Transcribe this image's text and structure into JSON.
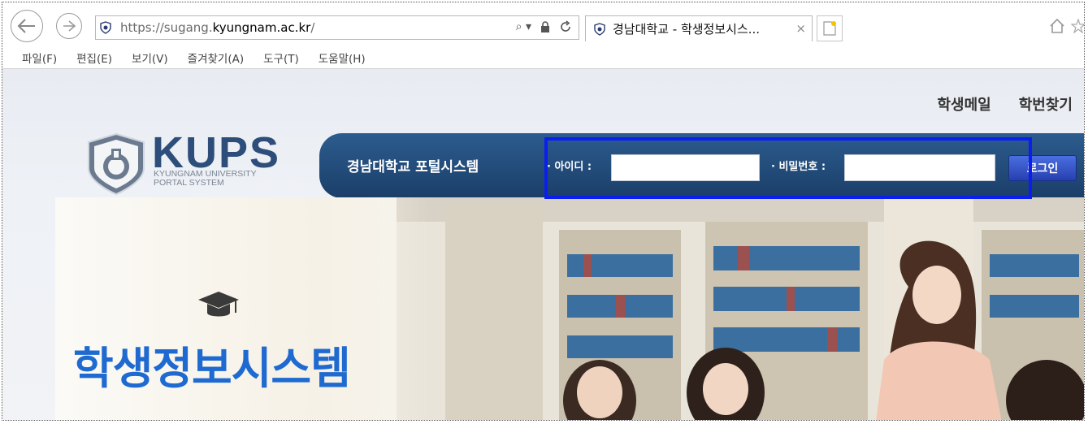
{
  "browser": {
    "url_prefix": "https://sugang.",
    "url_domain": "kyungnam.ac.kr",
    "url_suffix": "/",
    "tab_title": "경남대학교 - 학생정보시스...",
    "tab_close": "×",
    "search_glyph": "⌕ ▾",
    "menu": [
      "파일(F)",
      "편집(E)",
      "보기(V)",
      "즐겨찾기(A)",
      "도구(T)",
      "도움말(H)"
    ]
  },
  "header": {
    "links": [
      "학생메일",
      "학번찾기"
    ]
  },
  "logo": {
    "name": "KUPS",
    "sub_line1": "KYUNGNAM UNIVERSITY",
    "sub_line2": "PORTAL SYSTEM"
  },
  "login": {
    "portal_title": "경남대학교 포털시스템",
    "id_label": "· 아이디 :",
    "id_value": "",
    "pw_label": "· 비밀번호 :",
    "pw_value": "",
    "button_label": "로그인"
  },
  "hero": {
    "title": "학생정보시스템"
  },
  "colors": {
    "login_bar": "#1f4674",
    "highlight": "#0a1ef0",
    "hero_title": "#1f6ad0",
    "logo_text": "#2d4d7a"
  }
}
